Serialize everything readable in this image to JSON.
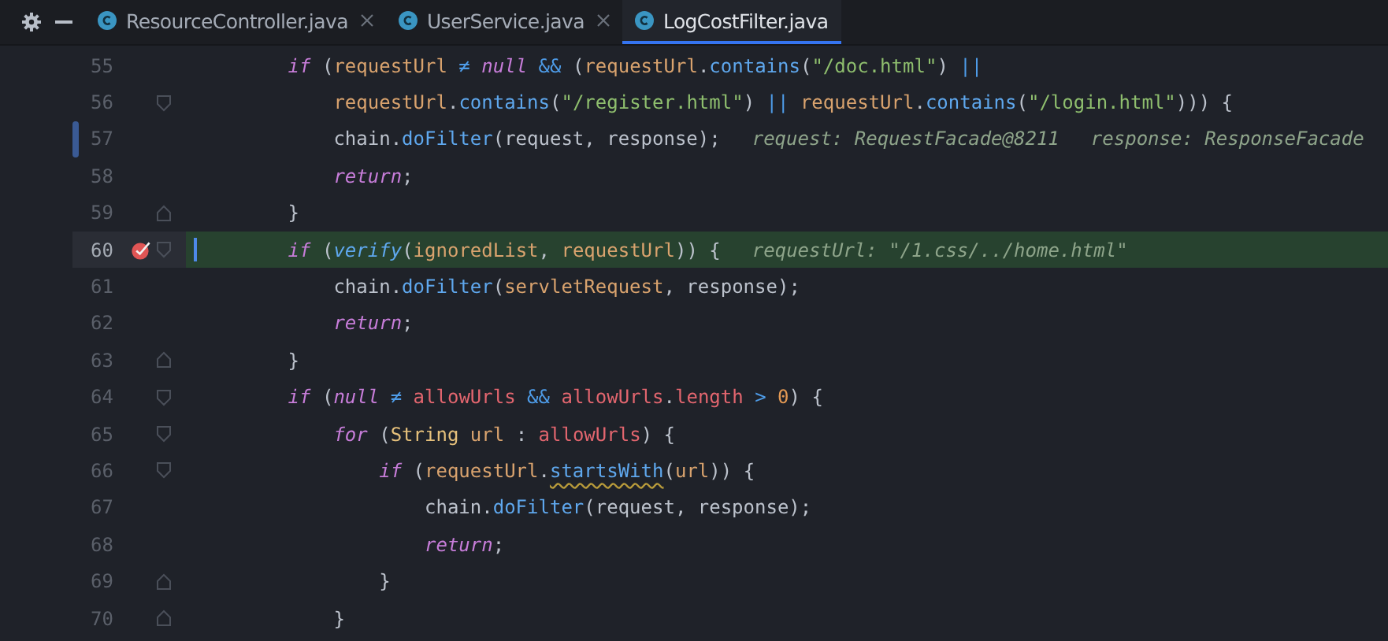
{
  "tab_bar": {
    "tabs": [
      {
        "label": "ResourceController.java",
        "selected": false,
        "closable": true
      },
      {
        "label": "UserService.java",
        "selected": false,
        "closable": true
      },
      {
        "label": "LogCostFilter.java",
        "selected": true,
        "closable": false
      }
    ]
  },
  "editor": {
    "lines": [
      {
        "number": "55",
        "breakpoint": false,
        "current": false,
        "changed": false,
        "caret": false,
        "fold_start": false,
        "fold_end": false,
        "tokens": [
          {
            "kind": "keyword",
            "text": "        if"
          },
          {
            "kind": "plain",
            "text": " ("
          },
          {
            "kind": "var",
            "text": "requestUrl"
          },
          {
            "kind": "op",
            "text": " ≠ "
          },
          {
            "kind": "keyword",
            "text": "null"
          },
          {
            "kind": "op",
            "text": " && "
          },
          {
            "kind": "plain",
            "text": "("
          },
          {
            "kind": "var",
            "text": "requestUrl"
          },
          {
            "kind": "plain",
            "text": "."
          },
          {
            "kind": "method",
            "text": "contains"
          },
          {
            "kind": "plain",
            "text": "("
          },
          {
            "kind": "string",
            "text": "\"/doc.html\""
          },
          {
            "kind": "plain",
            "text": ") "
          },
          {
            "kind": "op",
            "text": "||"
          }
        ]
      },
      {
        "number": "56",
        "breakpoint": false,
        "current": false,
        "changed": false,
        "caret": false,
        "fold_start": true,
        "fold_end": false,
        "tokens": [
          {
            "kind": "var",
            "text": "            requestUrl"
          },
          {
            "kind": "plain",
            "text": "."
          },
          {
            "kind": "method",
            "text": "contains"
          },
          {
            "kind": "plain",
            "text": "("
          },
          {
            "kind": "string",
            "text": "\"/register.html\""
          },
          {
            "kind": "plain",
            "text": ") "
          },
          {
            "kind": "op",
            "text": "||"
          },
          {
            "kind": "var",
            "text": " requestUrl"
          },
          {
            "kind": "plain",
            "text": "."
          },
          {
            "kind": "method",
            "text": "contains"
          },
          {
            "kind": "plain",
            "text": "("
          },
          {
            "kind": "string",
            "text": "\"/login.html\""
          },
          {
            "kind": "plain",
            "text": "))) {"
          }
        ]
      },
      {
        "number": "57",
        "breakpoint": false,
        "current": false,
        "changed": true,
        "caret": false,
        "fold_start": false,
        "fold_end": false,
        "tokens": [
          {
            "kind": "plain",
            "text": "            chain."
          },
          {
            "kind": "method",
            "text": "doFilter"
          },
          {
            "kind": "plain",
            "text": "(request, response);"
          },
          {
            "kind": "hint",
            "text": "request: RequestFacade@8211"
          },
          {
            "kind": "hint",
            "text": "response: ResponseFacade"
          }
        ]
      },
      {
        "number": "58",
        "breakpoint": false,
        "current": false,
        "changed": false,
        "caret": false,
        "fold_start": false,
        "fold_end": false,
        "tokens": [
          {
            "kind": "keyword",
            "text": "            return"
          },
          {
            "kind": "plain",
            "text": ";"
          }
        ]
      },
      {
        "number": "59",
        "breakpoint": false,
        "current": false,
        "changed": false,
        "caret": false,
        "fold_start": false,
        "fold_end": true,
        "tokens": [
          {
            "kind": "plain",
            "text": "        }"
          }
        ]
      },
      {
        "number": "60",
        "breakpoint": true,
        "current": true,
        "changed": false,
        "caret": true,
        "fold_start": true,
        "fold_end": false,
        "tokens": [
          {
            "kind": "keyword",
            "text": "        if"
          },
          {
            "kind": "plain",
            "text": " ("
          },
          {
            "kind": "static",
            "text": "verify"
          },
          {
            "kind": "plain",
            "text": "("
          },
          {
            "kind": "var",
            "text": "ignoredList"
          },
          {
            "kind": "plain",
            "text": ", "
          },
          {
            "kind": "var",
            "text": "requestUrl"
          },
          {
            "kind": "plain",
            "text": ")) {"
          },
          {
            "kind": "hint",
            "text": "requestUrl: \"/1.css/../home.html\""
          }
        ]
      },
      {
        "number": "61",
        "breakpoint": false,
        "current": false,
        "changed": false,
        "caret": false,
        "fold_start": false,
        "fold_end": false,
        "tokens": [
          {
            "kind": "plain",
            "text": "            chain."
          },
          {
            "kind": "method",
            "text": "doFilter"
          },
          {
            "kind": "plain",
            "text": "("
          },
          {
            "kind": "var",
            "text": "servletRequest"
          },
          {
            "kind": "plain",
            "text": ", response);"
          }
        ]
      },
      {
        "number": "62",
        "breakpoint": false,
        "current": false,
        "changed": false,
        "caret": false,
        "fold_start": false,
        "fold_end": false,
        "tokens": [
          {
            "kind": "keyword",
            "text": "            return"
          },
          {
            "kind": "plain",
            "text": ";"
          }
        ]
      },
      {
        "number": "63",
        "breakpoint": false,
        "current": false,
        "changed": false,
        "caret": false,
        "fold_start": false,
        "fold_end": true,
        "tokens": [
          {
            "kind": "plain",
            "text": "        }"
          }
        ]
      },
      {
        "number": "64",
        "breakpoint": false,
        "current": false,
        "changed": false,
        "caret": false,
        "fold_start": true,
        "fold_end": false,
        "tokens": [
          {
            "kind": "keyword",
            "text": "        if"
          },
          {
            "kind": "plain",
            "text": " ("
          },
          {
            "kind": "keyword",
            "text": "null"
          },
          {
            "kind": "op",
            "text": " ≠ "
          },
          {
            "kind": "field",
            "text": "allowUrls"
          },
          {
            "kind": "op",
            "text": " && "
          },
          {
            "kind": "field",
            "text": "allowUrls"
          },
          {
            "kind": "plain",
            "text": "."
          },
          {
            "kind": "field",
            "text": "length"
          },
          {
            "kind": "op",
            "text": " > "
          },
          {
            "kind": "number",
            "text": "0"
          },
          {
            "kind": "plain",
            "text": ") {"
          }
        ]
      },
      {
        "number": "65",
        "breakpoint": false,
        "current": false,
        "changed": false,
        "caret": false,
        "fold_start": true,
        "fold_end": false,
        "tokens": [
          {
            "kind": "keyword",
            "text": "            for"
          },
          {
            "kind": "plain",
            "text": " ("
          },
          {
            "kind": "type",
            "text": "String"
          },
          {
            "kind": "var",
            "text": " url"
          },
          {
            "kind": "plain",
            "text": " : "
          },
          {
            "kind": "field",
            "text": "allowUrls"
          },
          {
            "kind": "plain",
            "text": ") {"
          }
        ]
      },
      {
        "number": "66",
        "breakpoint": false,
        "current": false,
        "changed": false,
        "caret": false,
        "fold_start": true,
        "fold_end": false,
        "tokens": [
          {
            "kind": "keyword",
            "text": "                if"
          },
          {
            "kind": "plain",
            "text": " ("
          },
          {
            "kind": "var",
            "text": "requestUrl"
          },
          {
            "kind": "plain",
            "text": "."
          },
          {
            "kind": "warn",
            "text": "startsWith"
          },
          {
            "kind": "plain",
            "text": "("
          },
          {
            "kind": "var",
            "text": "url"
          },
          {
            "kind": "plain",
            "text": ")) {"
          }
        ]
      },
      {
        "number": "67",
        "breakpoint": false,
        "current": false,
        "changed": false,
        "caret": false,
        "fold_start": false,
        "fold_end": false,
        "tokens": [
          {
            "kind": "plain",
            "text": "                    chain."
          },
          {
            "kind": "method",
            "text": "doFilter"
          },
          {
            "kind": "plain",
            "text": "(request, response);"
          }
        ]
      },
      {
        "number": "68",
        "breakpoint": false,
        "current": false,
        "changed": false,
        "caret": false,
        "fold_start": false,
        "fold_end": false,
        "tokens": [
          {
            "kind": "keyword",
            "text": "                    return"
          },
          {
            "kind": "plain",
            "text": ";"
          }
        ]
      },
      {
        "number": "69",
        "breakpoint": false,
        "current": false,
        "changed": false,
        "caret": false,
        "fold_start": false,
        "fold_end": true,
        "tokens": [
          {
            "kind": "plain",
            "text": "                }"
          }
        ]
      },
      {
        "number": "70",
        "breakpoint": false,
        "current": false,
        "changed": false,
        "caret": false,
        "fold_start": false,
        "fold_end": true,
        "tokens": [
          {
            "kind": "plain",
            "text": "            }"
          }
        ]
      }
    ]
  }
}
